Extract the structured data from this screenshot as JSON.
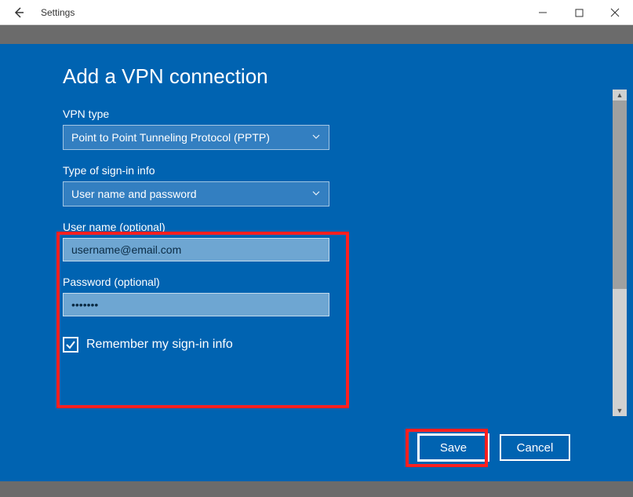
{
  "window": {
    "title": "Settings"
  },
  "panel": {
    "heading": "Add a VPN connection",
    "fields": {
      "vpn_type": {
        "label": "VPN type",
        "value": "Point to Point Tunneling Protocol (PPTP)"
      },
      "signin_type": {
        "label": "Type of sign-in info",
        "value": "User name and password"
      },
      "username": {
        "label": "User name (optional)",
        "value": "username@email.com"
      },
      "password": {
        "label": "Password (optional)",
        "value": "•••••••"
      },
      "remember": {
        "label": "Remember my sign-in info",
        "checked": true
      }
    },
    "buttons": {
      "save": "Save",
      "cancel": "Cancel"
    }
  }
}
